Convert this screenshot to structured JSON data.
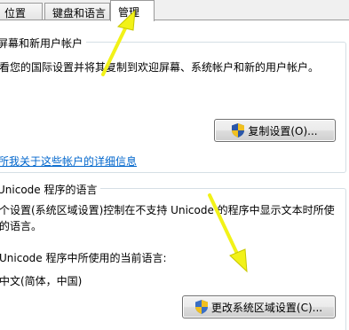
{
  "tabs": [
    {
      "label": "位置",
      "active": false
    },
    {
      "label": "键盘和语言",
      "active": false
    },
    {
      "label": "管理",
      "active": true
    }
  ],
  "welcome_group": {
    "title": "屏幕和新用户帐户",
    "description": "看您的国际设置并将其复制到欢迎屏幕、系统帐户和新的用户帐户。",
    "copy_button": "复制设置(O)...",
    "link": "所我关于这些帐户的详细信息"
  },
  "unicode_group": {
    "title": "Unicode 程序的语言",
    "description_line1": "个设置(系统区域设置)控制在不支持 Unicode 的程序中显示文本时所使",
    "description_line2": "的语言。",
    "current_label": "Unicode 程序中所使用的当前语言:",
    "current_value": "中文(简体，中国)",
    "change_button": "更改系统区域设置(C)..."
  },
  "colors": {
    "link": "#0066cc",
    "annotation_arrow": "#f2f218",
    "group_border": "#d5dfe5"
  }
}
